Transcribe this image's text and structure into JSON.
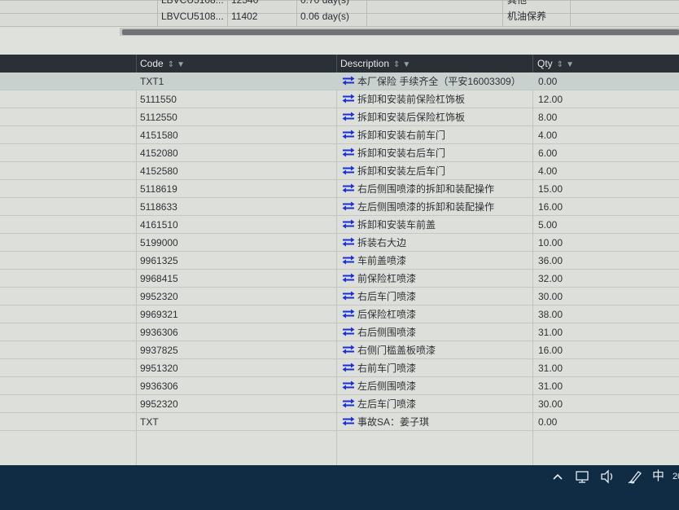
{
  "top_table": {
    "rows": [
      {
        "vin": "LBVCU5108...",
        "number": "12540",
        "duration": "0.70 day(s)",
        "category": "其他"
      },
      {
        "vin": "LBVCU5108...",
        "number": "11402",
        "duration": "0.06 day(s)",
        "category": "机油保养"
      }
    ]
  },
  "grid": {
    "columns": [
      {
        "label": "Code",
        "key": "code"
      },
      {
        "label": "Description",
        "key": "description"
      },
      {
        "label": "Qty",
        "key": "qty"
      }
    ],
    "rows": [
      {
        "code": "TXT1",
        "description": "本厂保险 手续齐全（平安16003309）",
        "qty": "0.00"
      },
      {
        "code": "5111550",
        "description": "拆卸和安装前保险杠饰板",
        "qty": "12.00"
      },
      {
        "code": "5112550",
        "description": "拆卸和安装后保险杠饰板",
        "qty": "8.00"
      },
      {
        "code": "4151580",
        "description": "拆卸和安装右前车门",
        "qty": "4.00"
      },
      {
        "code": "4152080",
        "description": "拆卸和安装右后车门",
        "qty": "6.00"
      },
      {
        "code": "4152580",
        "description": "拆卸和安装左后车门",
        "qty": "4.00"
      },
      {
        "code": "5118619",
        "description": "右后侧围喷漆的拆卸和装配操作",
        "qty": "15.00"
      },
      {
        "code": "5118633",
        "description": "左后侧围喷漆的拆卸和装配操作",
        "qty": "16.00"
      },
      {
        "code": "4161510",
        "description": "拆卸和安装车前盖",
        "qty": "5.00"
      },
      {
        "code": "5199000",
        "description": "拆装右大边",
        "qty": "10.00"
      },
      {
        "code": "9961325",
        "description": "车前盖喷漆",
        "qty": "36.00"
      },
      {
        "code": "9968415",
        "description": "前保险杠喷漆",
        "qty": "32.00"
      },
      {
        "code": "9952320",
        "description": "右后车门喷漆",
        "qty": "30.00"
      },
      {
        "code": "9969321",
        "description": "后保险杠喷漆",
        "qty": "38.00"
      },
      {
        "code": "9936306",
        "description": "右后侧围喷漆",
        "qty": "31.00"
      },
      {
        "code": "9937825",
        "description": "右侧门槛盖板喷漆",
        "qty": "16.00"
      },
      {
        "code": "9951320",
        "description": "右前车门喷漆",
        "qty": "31.00"
      },
      {
        "code": "9936306",
        "description": "左后侧围喷漆",
        "qty": "31.00"
      },
      {
        "code": "9952320",
        "description": "左后车门喷漆",
        "qty": "30.00"
      },
      {
        "code": "TXT",
        "description": "事故SA：姜子琪",
        "qty": "0.00"
      }
    ]
  },
  "taskbar": {
    "icons": [
      "chevron-up-icon",
      "network-icon",
      "volume-icon",
      "pen-icon"
    ],
    "ime_label": "中",
    "clock_partial": "20"
  },
  "colors": {
    "header_bg": "#2b3036",
    "row_bg": "#dde0da",
    "selected_row_bg": "#c9d1cf",
    "swap_icon": "#1a2fd6",
    "taskbar_bg": "#0f2c44"
  }
}
